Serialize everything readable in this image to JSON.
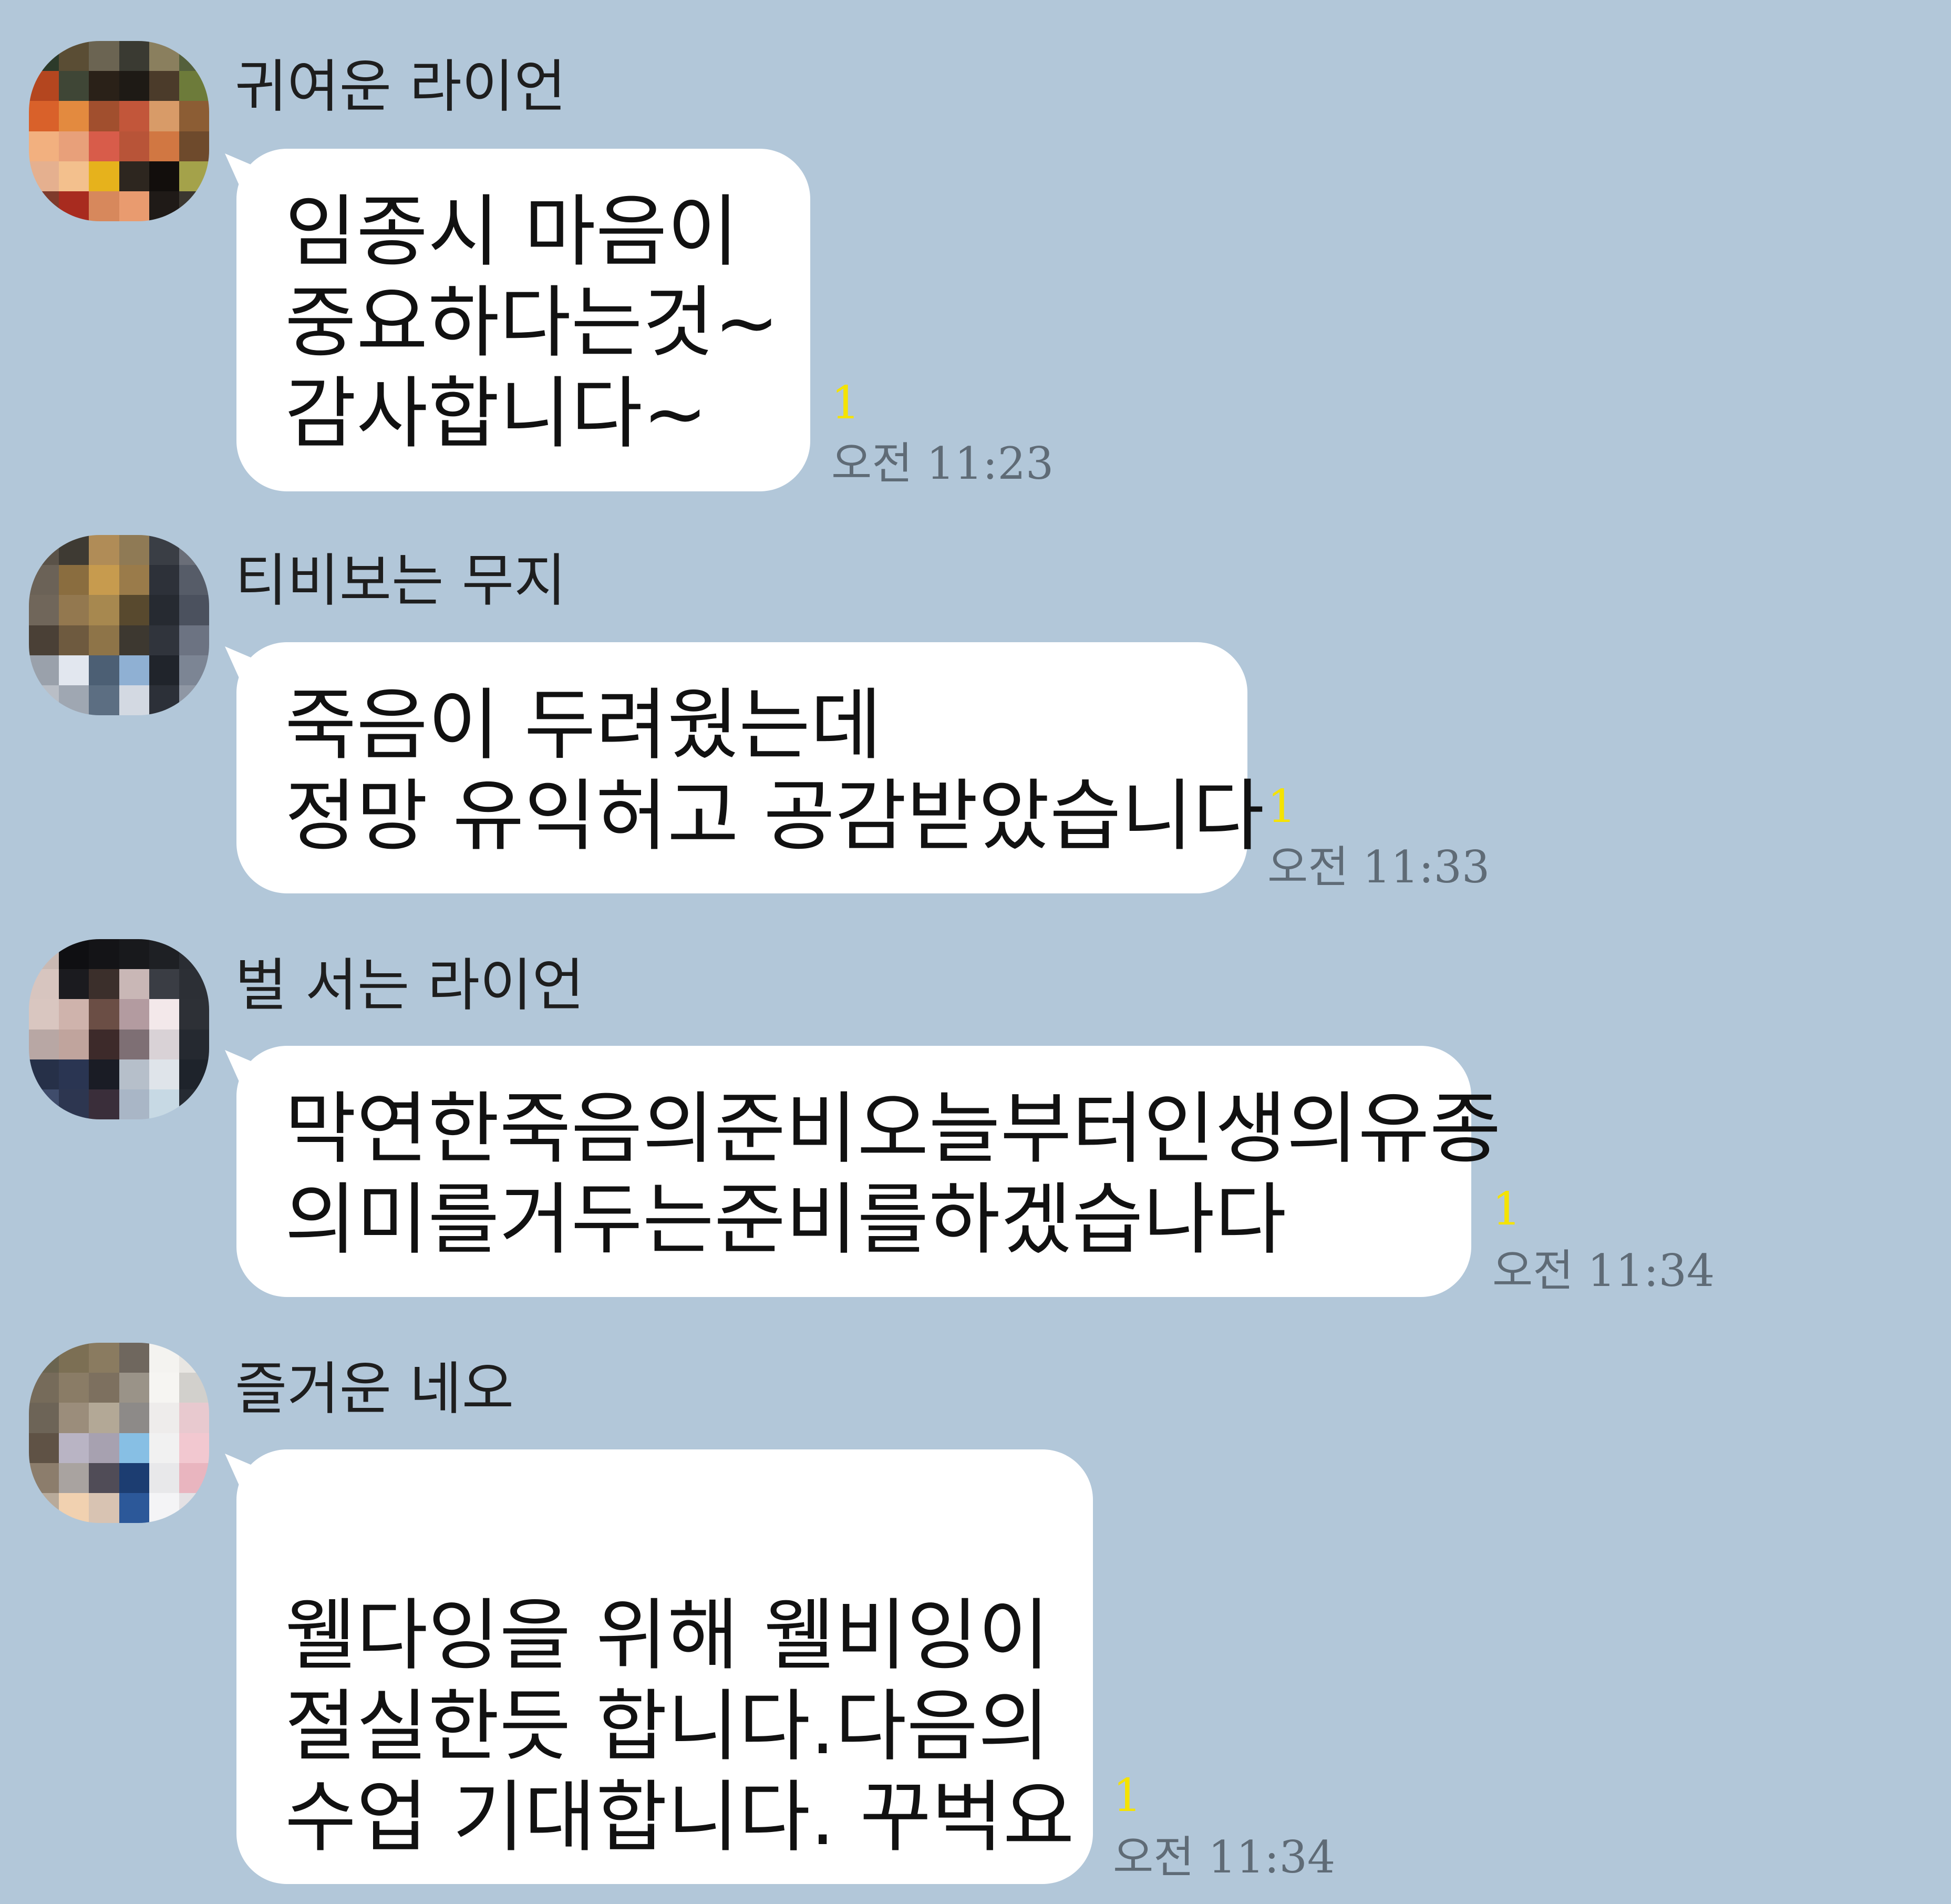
{
  "messages": [
    {
      "sender": "귀여운 라이언",
      "lines": [
        "임종시  마음이",
        "중요하다는것~",
        "감사합니다~"
      ],
      "unread": "1",
      "time": "오전 11:23"
    },
    {
      "sender": "티비보는 무지",
      "lines": [
        "죽음이 두려웠는데",
        "정망 유익허고 공감받았습니다"
      ],
      "unread": "1",
      "time": "오전 11:33"
    },
    {
      "sender": "벌 서는 라이언",
      "lines": [
        "막연한죽음의준비오늘부터인생의유종",
        "의미를거두는준비를하겠습나다"
      ],
      "unread": "1",
      "time": "오전 11:34"
    },
    {
      "sender": "즐거운 네오",
      "lines": [
        "웰다잉을 위해 웰비잉이",
        "절실한듯 합니다.다음의",
        "수업 기대합니다. 꾸벅요"
      ],
      "unread": "1",
      "time": "오전 11:34"
    }
  ],
  "colors": {
    "background": "#b2c7d9",
    "bubble": "#ffffff",
    "unread": "#f5e300",
    "time": "#5f6b76"
  }
}
